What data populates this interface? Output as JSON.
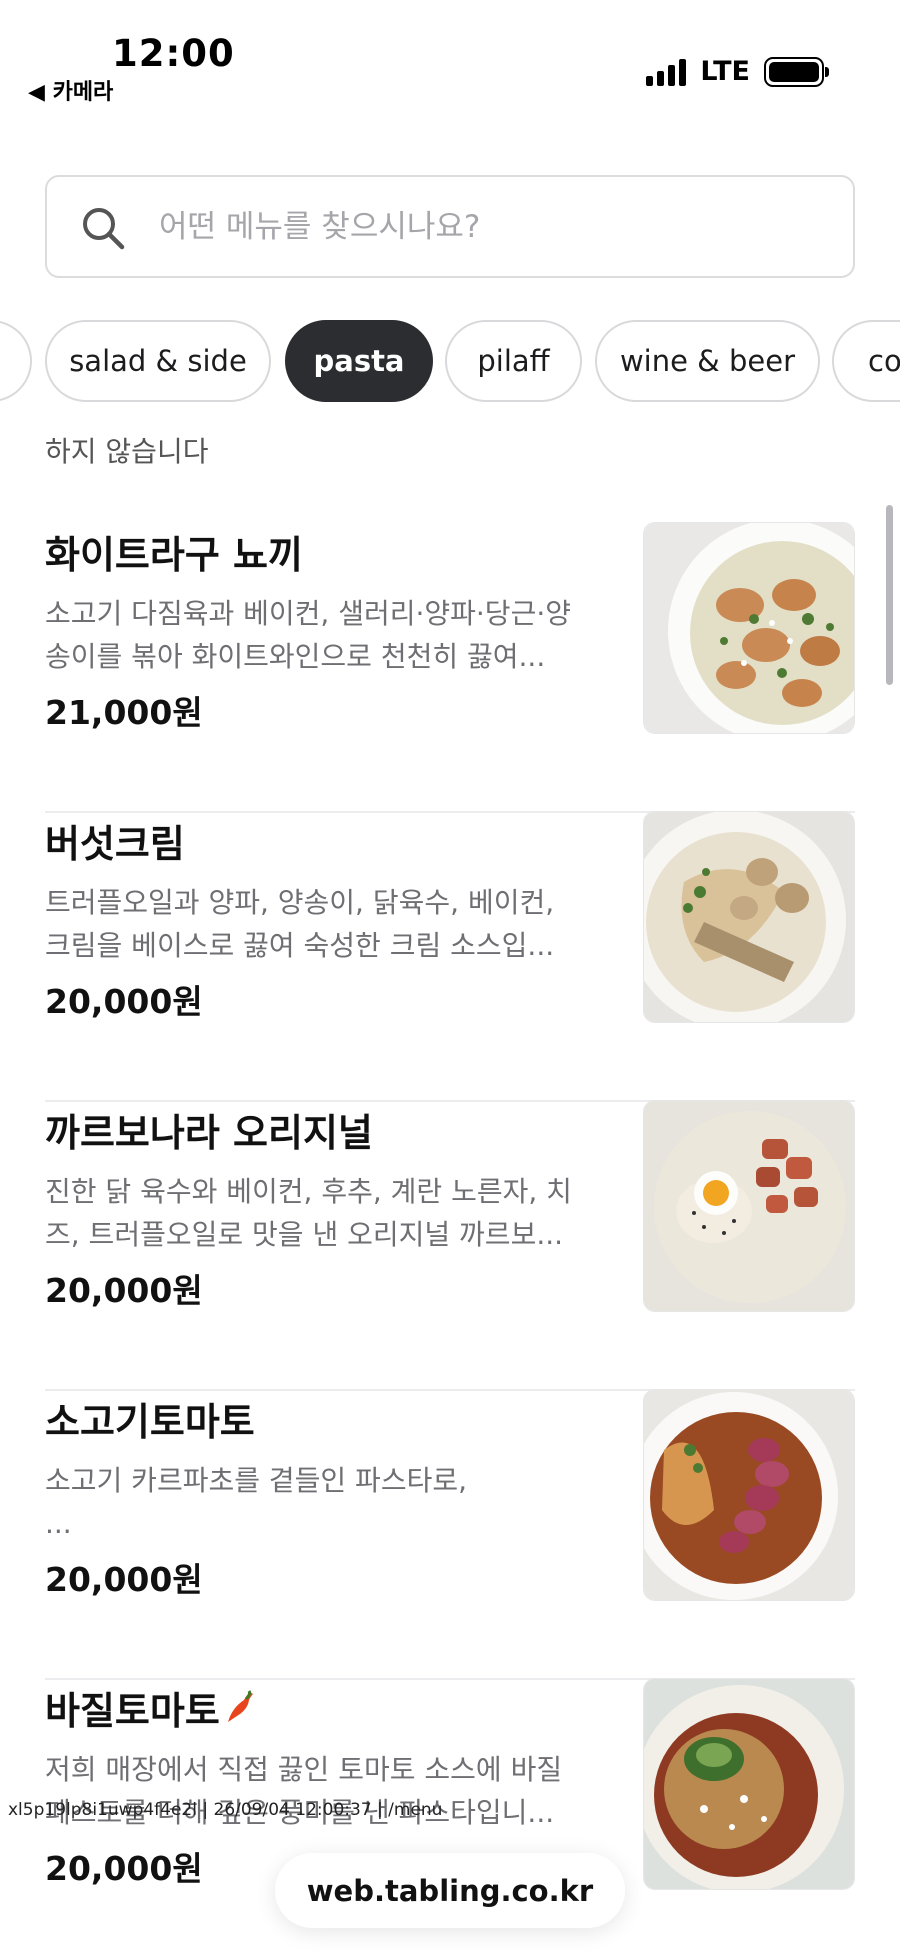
{
  "status_bar": {
    "time": "12:00",
    "back_label": "◀ 카메라",
    "network": "LTE"
  },
  "search": {
    "placeholder": "어떤 메뉴를 찾으시나요?",
    "value": ""
  },
  "categories": [
    {
      "label": "",
      "active": false
    },
    {
      "label": "salad & side",
      "active": false
    },
    {
      "label": "pasta",
      "active": true
    },
    {
      "label": "pilaff",
      "active": false
    },
    {
      "label": "wine & beer",
      "active": false
    },
    {
      "label": "co",
      "active": false
    }
  ],
  "section_note": "하지 않습니다",
  "menu": [
    {
      "name": "화이트라구 뇨끼",
      "description": "소고기 다짐육과 베이컨, 샐러리·양파·당근·양\n송이를  볶아 화이트와인으로 천천히 끓여...",
      "price": "21,000원",
      "image_icon": "gnocchi-photo"
    },
    {
      "name": "버섯크림",
      "description": "트러플오일과 양파, 양송이, 닭육수, 베이컨,\n크림을 베이스로 끓여 숙성한 크림 소스입...",
      "price": "20,000원",
      "image_icon": "mushroom-cream-photo"
    },
    {
      "name": "까르보나라 오리지널",
      "description": "진한 닭 육수와 베이컨, 후추, 계란 노른자, 치\n즈, 트러플오일로 맛을 낸 오리지널 까르보...",
      "price": "20,000원",
      "image_icon": "carbonara-photo"
    },
    {
      "name": "소고기토마토",
      "description": "소고기 카르파초를 곁들인 파스타로,\n...",
      "price": "20,000원",
      "image_icon": "beef-tomato-photo"
    },
    {
      "name": "바질토마토",
      "description": "저희 매장에서 직접 끓인 토마토 소스에 바질\n페스토를 더해 깊은 풍미를 낸 파스타입니...",
      "price": "20,000원",
      "image_icon": "basil-tomato-photo",
      "badge_icon": "chili-pepper-icon"
    }
  ],
  "watermark": "xl5p19lp8i1uwp4f4e2l | 26/09/04 12:00:37 | /menu",
  "url_bar": "web.tabling.co.kr",
  "colors": {
    "active_chip": "#2c2d31",
    "chip_border": "#d9d9dc",
    "muted_text": "#6e6e73",
    "chili": "#e8451e"
  }
}
